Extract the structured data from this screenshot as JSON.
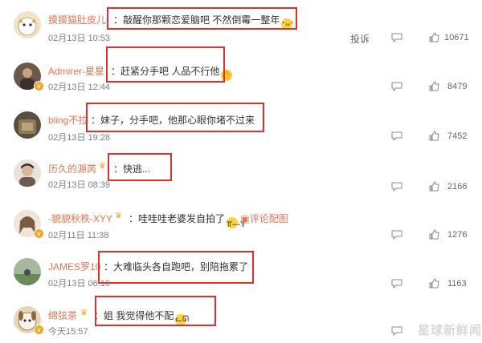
{
  "comments": [
    {
      "user": "摸摸猫肚皮儿",
      "text": "敲醒你那颗恋爱脑吧 不然倒霉一整年",
      "emoji": "😅",
      "time": "02月13日 10:53",
      "likes": "10671",
      "report": "投诉"
    },
    {
      "user": "Admirer-星星",
      "text": "赶紧分手吧 人品不行他",
      "emoji": "🤦",
      "time": "02月13日 12:44",
      "likes": "8479"
    },
    {
      "user": "bling不拉",
      "text": "妹子，分手吧，他那心眼你堵不过来",
      "time": "02月13日 19:28",
      "likes": "7452"
    },
    {
      "user": "历久的源芮",
      "text": "快逃...",
      "time": "02月13日 08:39",
      "likes": "2166"
    },
    {
      "user": "-貌貌秋秩-XYY",
      "text": "哇哇哇老婆发自拍了",
      "emoji": "😭",
      "link": "评论配图",
      "time": "02月11日 11:38",
      "likes": "1276"
    },
    {
      "user": "JAMES罗10",
      "text": "大难临头各自跑吧，别陪拖累了",
      "time": "02月13日 06:10",
      "likes": "1163"
    },
    {
      "user": "绵弦茶",
      "text": "姐 我觉得他不配",
      "emoji": "😾",
      "time": "今天15:57",
      "likes": ""
    }
  ],
  "watermark": "星球新鲜闻",
  "colors": {
    "username": "#eb7350",
    "highlight": "#e0302e",
    "badge": "#f5a623"
  }
}
